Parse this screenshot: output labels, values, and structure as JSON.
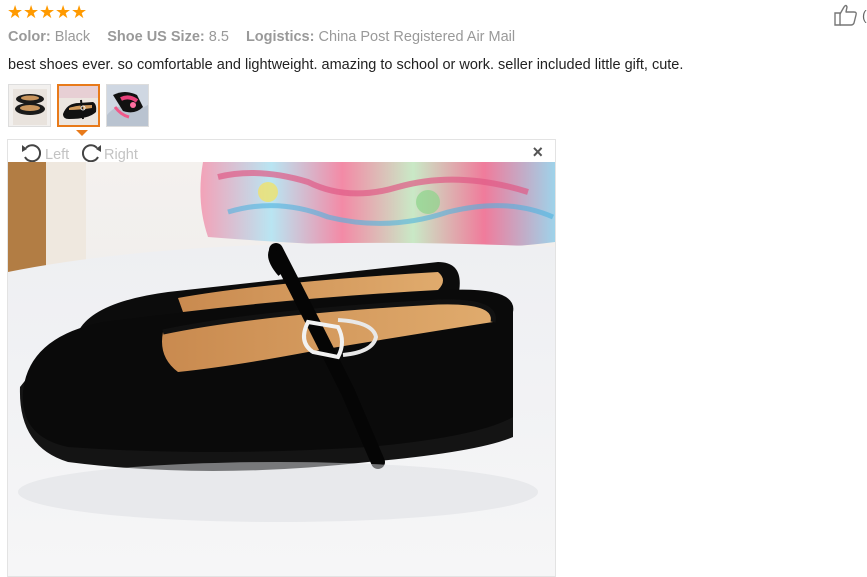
{
  "rating": {
    "stars": 5,
    "max": 5,
    "star_glyph": "★",
    "color": "#ff9a00"
  },
  "helpful": {
    "icon": "thumbs-up-icon",
    "count_text": "("
  },
  "attributes": [
    {
      "key": "Color:",
      "value": "Black"
    },
    {
      "key": "Shoe US Size:",
      "value": "8.5"
    },
    {
      "key": "Logistics:",
      "value": "China Post Registered Air Mail"
    }
  ],
  "review_text": "best shoes ever. so comfortable and lightweight. amazing to school or work. seller included little gift, cute.",
  "thumbnails": [
    {
      "name": "thumbnail-1",
      "selected": false
    },
    {
      "name": "thumbnail-2",
      "selected": true
    },
    {
      "name": "thumbnail-3",
      "selected": false
    }
  ],
  "viewer": {
    "rotate_left_label": "Left",
    "rotate_right_label": "Right",
    "close_symbol": "×"
  },
  "colors": {
    "accent": "#e87a1a",
    "muted": "#999999"
  }
}
